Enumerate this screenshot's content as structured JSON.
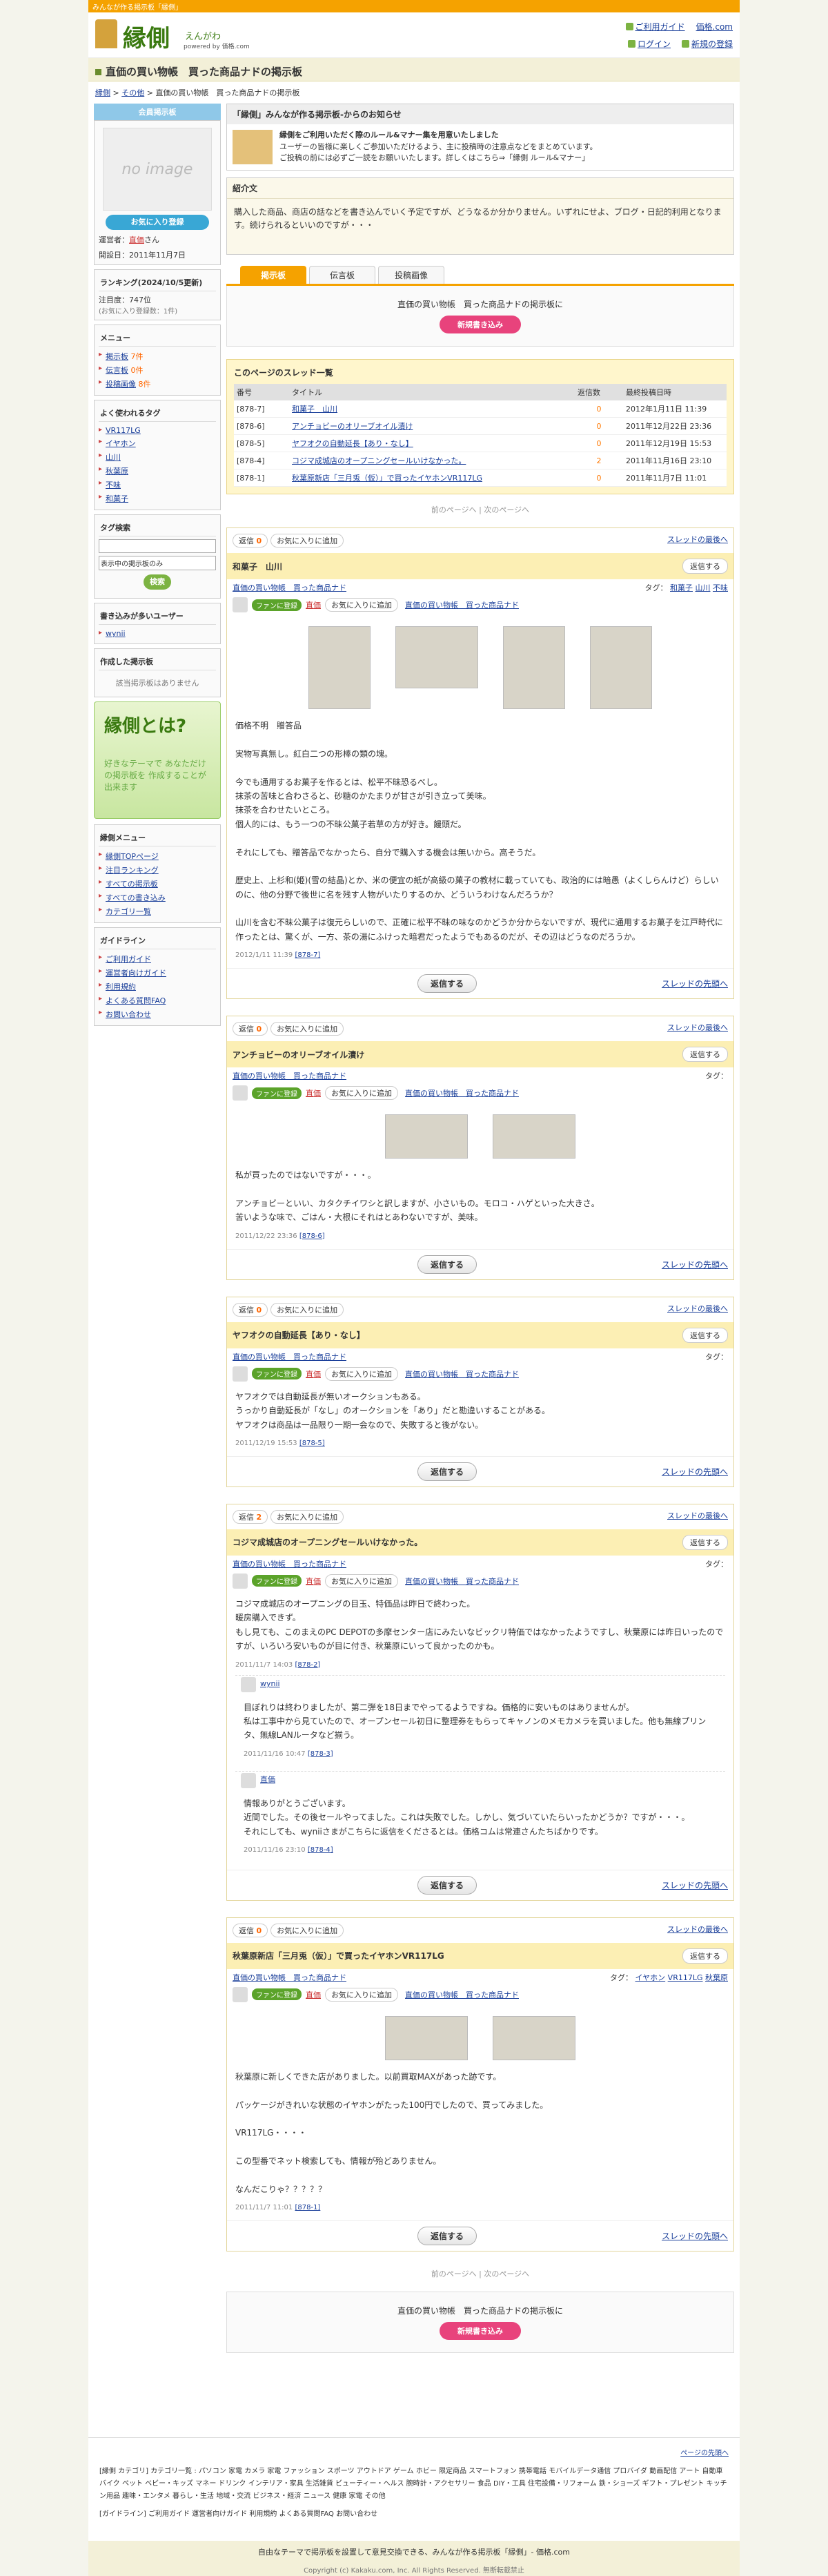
{
  "topbar": "みんなが作る掲示板「縁側」",
  "logo": {
    "name": "縁側",
    "kana": "えんがわ",
    "by": "powered by 価格.com"
  },
  "toplinks": {
    "guide": "ご利用ガイド",
    "kakaku": "価格.com",
    "login": "ログイン",
    "register": "新規の登録"
  },
  "page_title": "直価の買い物帳　買った商品ナドの掲示板",
  "breadcrumb": {
    "home": "縁側",
    "cat": "その他",
    "current": "直価の買い物帳　買った商品ナドの掲示板"
  },
  "side": {
    "member_head": "会員掲示板",
    "noimage": "no image",
    "fav_btn": "お気に入り登録",
    "admin_label": "運営者：",
    "admin_name": "直価",
    "admin_suffix": "さん",
    "opened": "開設日：2011年11月7日",
    "ranking_title": "ランキング(2024/10/5更新)",
    "ranking_value": "注目度：747位",
    "ranking_note": "(お気に入り登録数：1件)",
    "menu_title": "メニュー",
    "menu": [
      {
        "label": "掲示板",
        "count": "7件"
      },
      {
        "label": "伝言板",
        "count": "0件"
      },
      {
        "label": "投稿画像",
        "count": "8件"
      }
    ],
    "tags_title": "よく使われるタグ",
    "tags": [
      "VR117LG",
      "イヤホン",
      "山川",
      "秋葉原",
      "不味",
      "和菓子"
    ],
    "tagsearch_title": "タグ検索",
    "tagsearch_select": "表示中の掲示板のみ",
    "tagsearch_btn": "検索",
    "writers_title": "書き込みが多いユーザー",
    "writers": [
      "wynii"
    ],
    "created_title": "作成した掲示板",
    "created_none": "該当掲示板はありません",
    "banner_big": "縁側とは?",
    "banner_small": "好きなテーマで あなただけの掲示板を 作成することが出来ます",
    "engawa_menu_title": "縁側メニュー",
    "engawa_menu": [
      "縁側TOPページ",
      "注目ランキング",
      "すべての掲示板",
      "すべての書き込み",
      "カテゴリ一覧"
    ],
    "guide_title": "ガイドライン",
    "guide": [
      "ご利用ガイド",
      "運営者向けガイド",
      "利用規約",
      "よくある質問FAQ",
      "お問い合わせ"
    ]
  },
  "notice": {
    "head": "「縁側」みんなが作る掲示板-からのお知らせ",
    "l1": "縁側をご利用いただく際のルール&マナー集を用意いたしました",
    "l2": "ユーザーの皆様に楽しくご参加いただけるよう、主に投稿時の注意点などをまとめています。",
    "l3": "ご投稿の前には必ずご一読をお願いいたします。詳しくはこちら⇒「縁側 ルール&マナー」"
  },
  "intro": {
    "head": "紹介文",
    "body": "購入した商品、商店の話などを書き込んでいく予定ですが、どうなるか分かりません。いずれにせよ、ブログ・日記的利用となります。続けられるといいのですが・・・"
  },
  "tabs": [
    "掲示板",
    "伝言板",
    "投稿画像"
  ],
  "postbox": {
    "text": "直価の買い物帳　買った商品ナドの掲示板に",
    "btn": "新規書き込み"
  },
  "threadlist": {
    "title": "このページのスレッド一覧",
    "headers": [
      "番号",
      "タイトル",
      "返信数",
      "最終投稿日時"
    ],
    "rows": [
      {
        "no": "[878-7]",
        "title": "和菓子　山川",
        "count": "0",
        "date": "2012年1月11日 11:39"
      },
      {
        "no": "[878-6]",
        "title": "アンチョビーのオリーブオイル漬け",
        "count": "0",
        "date": "2011年12月22日 23:36"
      },
      {
        "no": "[878-5]",
        "title": "ヤフオクの自動延長【あり・なし】",
        "count": "0",
        "date": "2011年12月19日 15:53"
      },
      {
        "no": "[878-4]",
        "title": "コジマ成城店のオープニングセールいけなかった。",
        "count": "2",
        "date": "2011年11月16日 23:10"
      },
      {
        "no": "[878-1]",
        "title": "秋葉原新店「三月兎（仮）」で買ったイヤホンVR117LG",
        "count": "0",
        "date": "2011年11月7日 11:01"
      }
    ]
  },
  "pager": {
    "prev": "前のページへ",
    "next": "次のページへ"
  },
  "common": {
    "reply_count_label": "返信",
    "fav_badge": "お気に入りに追加",
    "to_last": "スレッドの最後へ",
    "to_top": "スレッドの先頭へ",
    "reply": "返信する",
    "reply_small": "返信する",
    "board_link": "直価の買い物帳　買った商品ナド",
    "tag_label": "タグ：",
    "admin_chip": "ファンに登録",
    "fav_small": "お気に入りに追加",
    "board_small": "直価の買い物帳　買った商品ナド"
  },
  "threads": [
    {
      "count": "0",
      "title": "和菓子　山川",
      "tags": [
        "和菓子",
        "山川",
        "不味"
      ],
      "author": "直価",
      "body": "価格不明　贈答品\n\n実物写真無し。紅白二つの形棒の類の塊。\n\n今でも通用するお菓子を作るとは、松平不昧恐るべし。\n抹茶の苦味と合わさると、砂糖のかたまりが甘さが引き立って美味。\n抹茶を合わせたいところ。\n個人的には、もう一つの不昧公菓子若草の方が好き。饅頭だ。\n\nそれにしても、贈答品でなかったら、自分で購入する機会は無いから。高そうだ。\n\n歴史上、上杉和(姫)(雪の結晶)とか、米の便宜の紙が高級の菓子の教材に載っていても、政治的には暗愚（よくしらんけど）らしいのに、他の分野で後世に名を残す人物がいたりするのか、どういうわけなんだろうか？\n\n山川を含む不昧公菓子は復元らしいので、正確に松平不昧の味なのかどうか分からないですが、現代に通用するお菓子を江戸時代に作ったとは、驚くが、一方、茶の湯にふけった暗君だったようでもあるのだが、その辺はどうなのだろうか。",
      "date": "2012/1/11 11:39",
      "id": "[878-7]",
      "imgs": 4
    },
    {
      "count": "0",
      "title": "アンチョビーのオリーブオイル漬け",
      "tags": [],
      "author": "直価",
      "body": "私が買ったのではないですが・・・。\n\nアンチョビーといい、カタクチイワシと訳しますが、小さいもの。モロコ・ハゲといった大きさ。\n苦いような味で、ごはん・大根にそれはとあわないですが、美味。",
      "date": "2011/12/22 23:36",
      "id": "[878-6]",
      "imgs": 2
    },
    {
      "count": "0",
      "title": "ヤフオクの自動延長【あり・なし】",
      "tags": [],
      "author": "直価",
      "body": "ヤフオクでは自動延長が無いオークションもある。\nうっかり自動延長が「なし」のオークションを「あり」だと勘違いすることがある。\nヤフオクは商品は一品限り一期一会なので、失敗すると後がない。",
      "date": "2011/12/19 15:53",
      "id": "[878-5]",
      "imgs": 0
    },
    {
      "count": "2",
      "title": "コジマ成城店のオープニングセールいけなかった。",
      "tags": [],
      "author": "直価",
      "body": "コジマ成城店のオープニングの目玉、特価品は昨日で終わった。\n暖房購入できず。\nもし見ても、このまえのPC DEPOTの多摩センター店にみたいなビックリ特価ではなかったようですし、秋葉原には昨日いったのですが、いろいろ安いものが目に付き、秋葉原にいって良かったのかも。",
      "date": "2011/11/7 14:03",
      "id": "[878-2]",
      "imgs": 0,
      "replies": [
        {
          "author": "wynii",
          "body": "目ぼれりは終わりましたが、第二弾を18日までやってるようですね。価格的に安いものはありませんが。\n私は工事中から見ていたので、オープンセール初日に整理券をもらってキャノンのメモカメラを買いました。他も無線プリンタ、無線LANルータなど揃う。",
          "date": "2011/11/16 10:47",
          "id": "[878-3]"
        },
        {
          "author": "直価",
          "body": "情報ありがとうございます。\n近間でした。その後セールやってました。これは失敗でした。しかし、気づいていたらいったかどうか？ですが・・・。\nそれにしても、wyniiさまがこちらに返信をくださるとは。価格コムは常連さんたちばかりです。",
          "date": "2011/11/16 23:10",
          "id": "[878-4]"
        }
      ]
    },
    {
      "count": "0",
      "title": "秋葉原新店「三月兎（仮）」で買ったイヤホンVR117LG",
      "tags": [
        "イヤホン",
        "VR117LG",
        "秋葉原"
      ],
      "author": "直価",
      "body": "秋葉原に新しくできた店がありました。以前買取MAXがあった跡です。\n\nパッケージがきれいな状態のイヤホンがたった100円でしたので、買ってみました。\n\nVR117LG・・・・\n\nこの型番でネット検索しても、情報が殆どありません。\n\nなんだこりゃ？？？？？",
      "date": "2011/11/7 11:01",
      "id": "[878-1]",
      "imgs": 2
    }
  ],
  "footer": {
    "to_top": "ページの先頭へ",
    "cats": "[縁側 カテゴリ] カテゴリ一覧 : パソコン  家電  カメラ  家電  ファッション  スポーツ  アウトドア  ゲーム  ホビー  限定商品  スマートフォン  携帯電話  モバイルデータ通信  プロバイダ  動画配信  アート  自動車  バイク  ペット  ベビー・キッズ  マネー  ドリンク  インテリア・家具  生活雑貨  ビューティー・ヘルス  腕時計・アクセサリー  食品  DIY・工具  住宅設備・リフォーム  鉄・ショーズ  ギフト・プレゼント  キッチン用品  趣味・エンタメ  暮らし・生活  地域・交流  ビジネス・経済  ニュース  健康  家電  その他",
    "guide_line": "[ガイドライン]  ご利用ガイド  運営者向けガイド  利用規約  よくある質問FAQ  お問い合わせ",
    "tagline": "自由なテーマで掲示板を設置して意見交換できる、みんなが作る掲示板「縁側」- 価格.com",
    "copyright": "Copyright (c) Kakaku.com, Inc. All Rights Reserved. 無断転載禁止"
  }
}
